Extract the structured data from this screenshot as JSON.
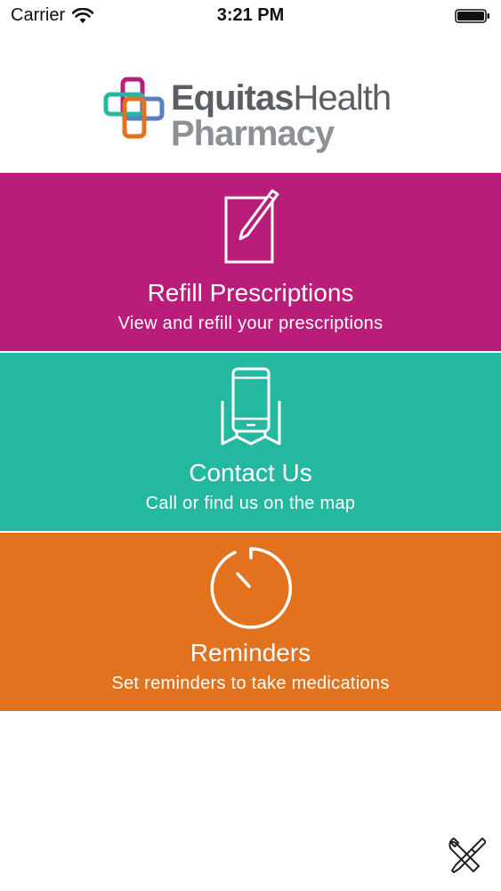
{
  "status_bar": {
    "carrier": "Carrier",
    "time": "3:21 PM",
    "wifi_icon": "wifi-icon",
    "battery_icon": "battery-full-icon"
  },
  "logo": {
    "line1_bold": "Equitas",
    "line1_light": "Health",
    "line2": "Pharmacy",
    "colors": {
      "magenta": "#b91c79",
      "teal": "#25b8a1",
      "orange": "#e3721f",
      "text_dark": "#5b5e63",
      "text_light": "#8d9094"
    }
  },
  "menu": {
    "items": [
      {
        "title": "Refill Prescriptions",
        "subtitle": "View and refill your prescriptions",
        "icon": "prescription-pad-icon",
        "color": "#b91c79"
      },
      {
        "title": "Contact Us",
        "subtitle": "Call or find us on the map",
        "icon": "phone-map-icon",
        "color": "#25b8a1"
      },
      {
        "title": "Reminders",
        "subtitle": "Set reminders to take medications",
        "icon": "timer-icon",
        "color": "#e3721f"
      }
    ]
  },
  "footer": {
    "settings_icon": "tools-icon"
  }
}
